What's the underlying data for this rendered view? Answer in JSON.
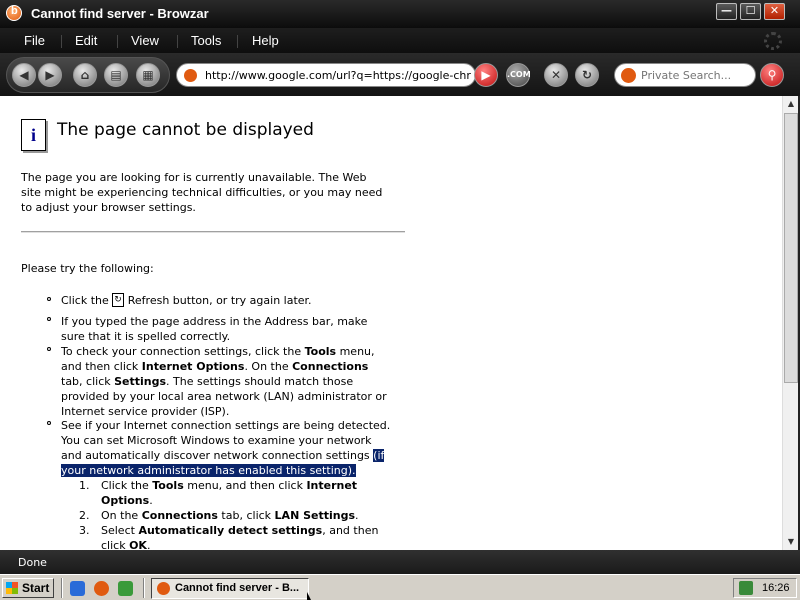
{
  "window": {
    "title": "Cannot find server - Browzar",
    "min_glyph": "—",
    "max_glyph": "☐",
    "close_glyph": "✕"
  },
  "menu": {
    "items": [
      "File",
      "Edit",
      "View",
      "Tools",
      "Help"
    ]
  },
  "toolbar": {
    "address": "http://www.google.com/url?q=https://google-chrome.",
    "search_placeholder": "Private Search...",
    "com_label": ".COM",
    "icons": [
      "back-icon",
      "forward-icon",
      "home-icon",
      "print-icon",
      "page-icon",
      "go-icon",
      "com-icon",
      "stop-icon",
      "refresh-icon",
      "search-go-icon"
    ]
  },
  "content": {
    "heading": "The page cannot be displayed",
    "intro": [
      "The page you are looking for is currently unavailable. The Web",
      "site might be experiencing technical difficulties, or you may need",
      "to adjust your browser settings."
    ],
    "try_label": "Please try the following:",
    "bullet1": {
      "before": "Click the",
      "after": "Refresh button, or try again later."
    },
    "bullet2": [
      "If you typed the page address in the Address bar, make",
      "sure that it is spelled correctly."
    ],
    "bullet3": {
      "l1a": "To check your connection settings, click the ",
      "l1b": "Tools",
      "l1c": " menu,",
      "l2a": "and then click ",
      "l2b": "Internet Options",
      "l2c": ". On the ",
      "l2d": "Connections",
      "l3a": "tab, click ",
      "l3b": "Settings",
      "l3c": ". The settings should match those",
      "l4": "provided by your local area network (LAN) administrator or",
      "l5": "Internet service provider (ISP)."
    },
    "bullet4": {
      "l1": "See if your Internet connection settings are being detected.",
      "l2": "You can set Microsoft Windows to examine your network",
      "l3a": "and automatically discover network connection settings ",
      "l3b": "(if",
      "l4": "your network administrator has enabled this setting)."
    },
    "steps": {
      "n1": "1.",
      "s1a": "Click the ",
      "s1b": "Tools",
      "s1c": " menu, and then click ",
      "s1d": "Internet",
      "s1e": "Options",
      "s1f": ".",
      "n2": "2.",
      "s2a": "On the ",
      "s2b": "Connections",
      "s2c": " tab, click ",
      "s2d": "LAN Settings",
      "s2e": ".",
      "n3": "3.",
      "s3a": "Select ",
      "s3b": "Automatically detect settings",
      "s3c": ", and then",
      "s3d": "click ",
      "s3e": "OK",
      "s3f": "."
    }
  },
  "status": {
    "text": "Done"
  },
  "taskbar": {
    "start": "Start",
    "task_label": "Cannot find server - B...",
    "clock": "16:26"
  }
}
